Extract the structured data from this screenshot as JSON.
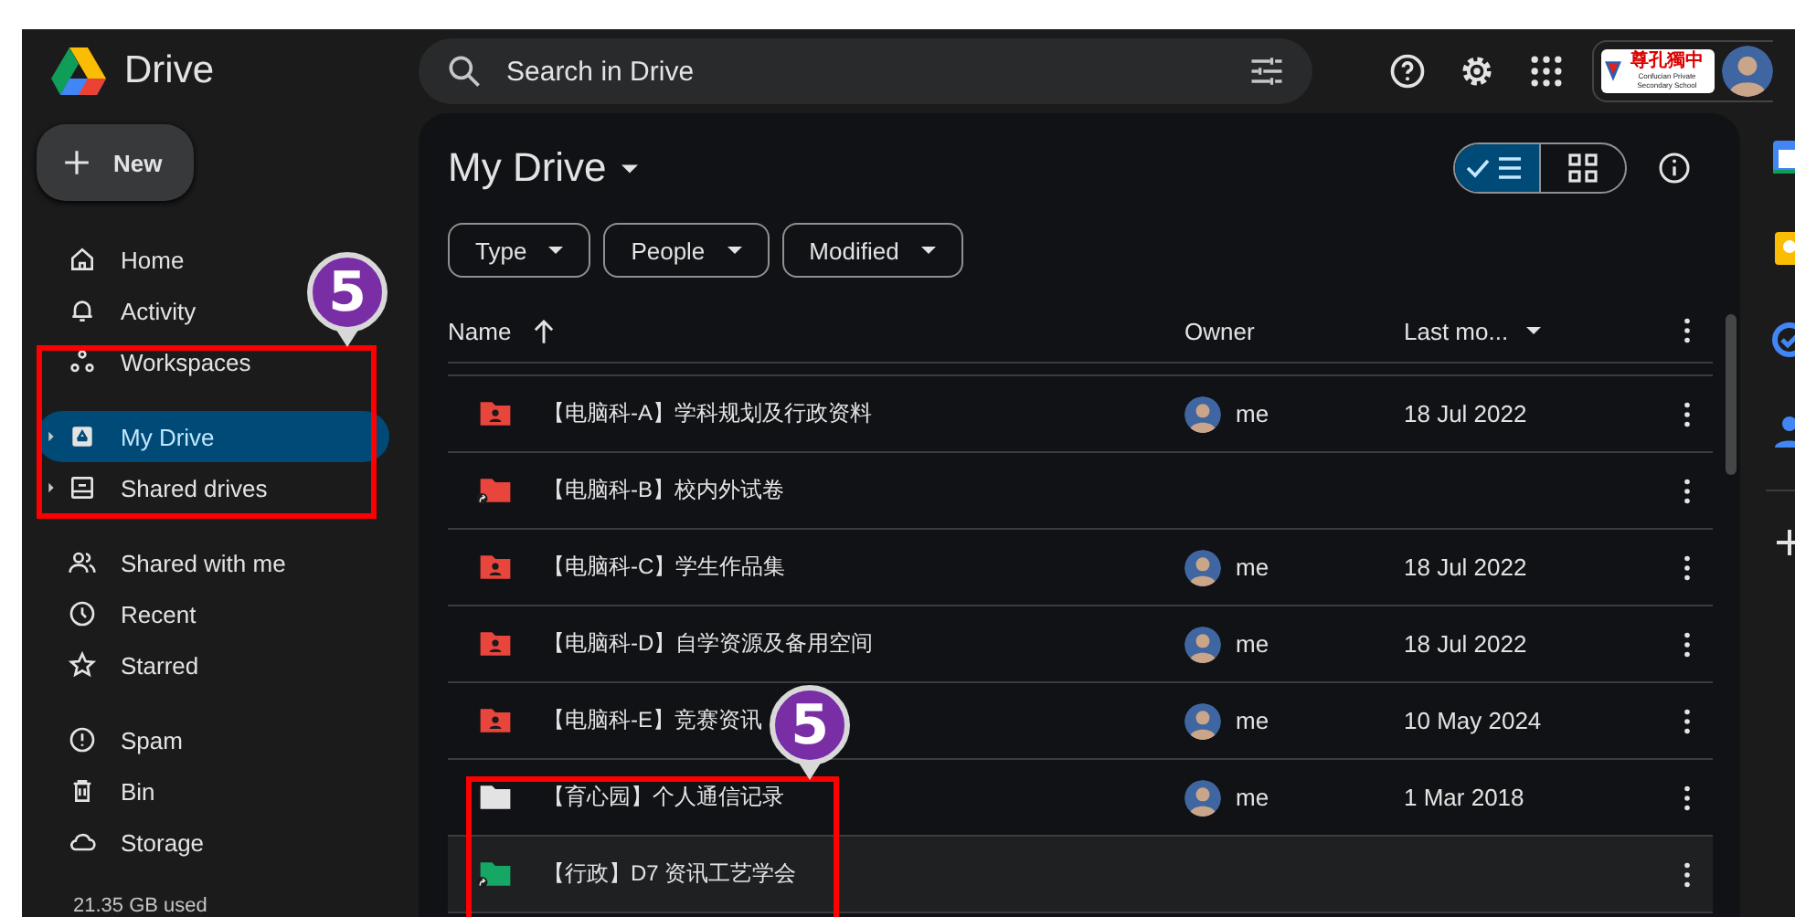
{
  "app": {
    "name": "Drive"
  },
  "search": {
    "placeholder": "Search in Drive"
  },
  "account": {
    "logo_name": "尊孔獨中",
    "logo_subtitle": "Confucian Private Secondary School"
  },
  "new_button": {
    "label": "New"
  },
  "nav_groups": [
    [
      {
        "label": "Home",
        "kind": "home",
        "selected": false,
        "expandable": false
      },
      {
        "label": "Activity",
        "kind": "bell",
        "selected": false,
        "expandable": false
      },
      {
        "label": "Workspaces",
        "kind": "workspaces",
        "selected": false,
        "expandable": false
      }
    ],
    [
      {
        "label": "My Drive",
        "kind": "drive",
        "selected": true,
        "expandable": true
      },
      {
        "label": "Shared drives",
        "kind": "shared-drives",
        "selected": false,
        "expandable": true
      }
    ],
    [
      {
        "label": "Shared with me",
        "kind": "people",
        "selected": false,
        "expandable": false
      },
      {
        "label": "Recent",
        "kind": "clock",
        "selected": false,
        "expandable": false
      },
      {
        "label": "Starred",
        "kind": "star",
        "selected": false,
        "expandable": false
      }
    ],
    [
      {
        "label": "Spam",
        "kind": "spam",
        "selected": false,
        "expandable": false
      },
      {
        "label": "Bin",
        "kind": "bin",
        "selected": false,
        "expandable": false
      },
      {
        "label": "Storage",
        "kind": "cloud",
        "selected": false,
        "expandable": false
      }
    ]
  ],
  "storage": {
    "usage": "21.35 GB used"
  },
  "main": {
    "title": "My Drive",
    "list_view_selected": true,
    "filters": [
      "Type",
      "People",
      "Modified"
    ],
    "columns": [
      "Name",
      "Owner",
      "Last mo..."
    ],
    "rows": [
      {
        "name": "【电脑科-A】学科规划及行政资料",
        "kind": "shared",
        "shortcut": false,
        "color": "#e8453c",
        "owner": "me",
        "modified": "18 Jul 2022",
        "highlighted": false
      },
      {
        "name": "【电脑科-B】校内外试卷",
        "kind": "plain",
        "shortcut": true,
        "color": "#e8453c",
        "highlighted": false
      },
      {
        "name": "【电脑科-C】学生作品集",
        "kind": "shared",
        "shortcut": false,
        "color": "#e8453c",
        "owner": "me",
        "modified": "18 Jul 2022",
        "highlighted": false
      },
      {
        "name": "【电脑科-D】自学资源及备用空间",
        "kind": "shared",
        "shortcut": false,
        "color": "#e8453c",
        "owner": "me",
        "modified": "18 Jul 2022",
        "highlighted": false
      },
      {
        "name": "【电脑科-E】竞赛资讯",
        "kind": "shared",
        "shortcut": false,
        "color": "#e8453c",
        "owner": "me",
        "modified": "10 May 2024",
        "highlighted": false
      },
      {
        "name": "【育心园】个人通信记录",
        "kind": "plain",
        "shortcut": false,
        "color": "#e3e3e3",
        "owner": "me",
        "modified": "1 Mar 2018",
        "highlighted": false
      },
      {
        "name": "【行政】D7 资讯工艺学会",
        "kind": "plain",
        "shortcut": true,
        "color": "#16a765",
        "highlighted": true
      }
    ]
  },
  "annotations": [
    {
      "label": "5"
    },
    {
      "label": "5"
    }
  ]
}
